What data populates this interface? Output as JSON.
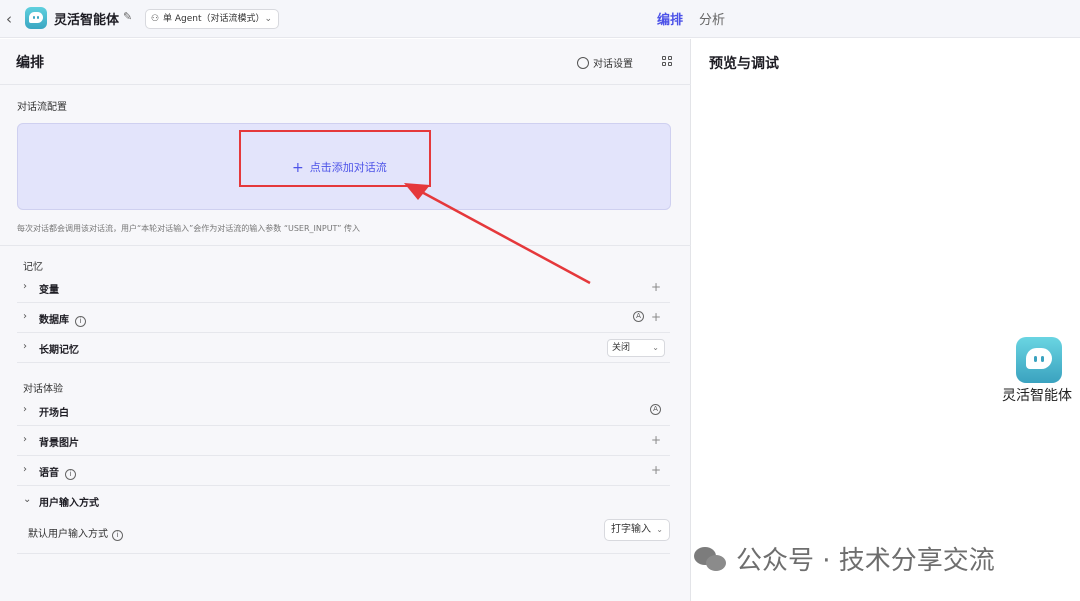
{
  "topbar": {
    "app_title": "灵活智能体",
    "mode_label": "单 Agent（对话流模式）",
    "tabs": [
      {
        "label": "编排",
        "active": true
      },
      {
        "label": "分析",
        "active": false
      }
    ]
  },
  "editor": {
    "title": "编排",
    "dialog_settings": "对话设置",
    "flow_section": {
      "label": "对话流配置",
      "add_button": "点击添加对话流",
      "hint": "每次对话都会调用该对话流，用户“本轮对话输入”会作为对话流的输入参数 “USER_INPUT” 传入"
    },
    "memory": {
      "label": "记忆",
      "items": [
        {
          "label": "变量"
        },
        {
          "label": "数据库"
        },
        {
          "label": "长期记忆",
          "select_value": "关闭"
        }
      ]
    },
    "experience": {
      "label": "对话体验",
      "items": [
        {
          "label": "开场白"
        },
        {
          "label": "背景图片"
        },
        {
          "label": "语音"
        },
        {
          "label": "用户输入方式"
        }
      ],
      "input_method": {
        "label": "默认用户输入方式",
        "value": "打字输入"
      }
    }
  },
  "preview": {
    "title": "预览与调试",
    "agent_name": "灵活智能体"
  },
  "watermark": "公众号 · 技术分享交流",
  "colors": {
    "accent": "#4d53e8",
    "annotation": "#e5383b",
    "flow_box_bg": "#e3e4fb"
  }
}
